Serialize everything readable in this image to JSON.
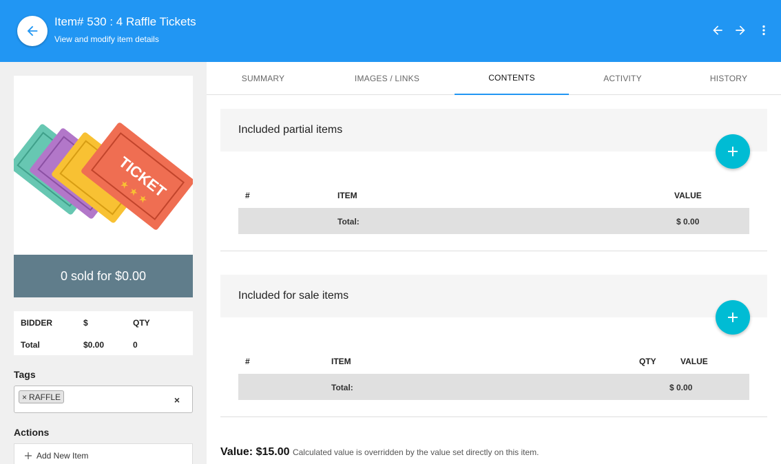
{
  "header": {
    "title": "Item# 530 : 4 Raffle Tickets",
    "subtitle": "View and modify item details",
    "back_icon": "arrow-left-icon",
    "prev_icon": "arrow-left-icon",
    "next_icon": "arrow-right-icon",
    "menu_icon": "more-vert-icon",
    "color": "#2196f3"
  },
  "sidebar": {
    "image_label": "TICKET",
    "sold_summary": "0 sold for $0.00",
    "bid_table": {
      "headers": [
        "BIDDER",
        "$",
        "QTY"
      ],
      "total_label": "Total",
      "total_amount": "$0.00",
      "total_qty": "0"
    },
    "tags_label": "Tags",
    "tags": [
      "RAFFLE"
    ],
    "tag_remove": "×",
    "tags_clear": "×",
    "actions_label": "Actions",
    "actions": [
      "Add New Item"
    ],
    "add_icon": "plus-icon"
  },
  "tabs": [
    {
      "label": "SUMMARY",
      "active": false
    },
    {
      "label": "IMAGES / LINKS",
      "active": false
    },
    {
      "label": "CONTENTS",
      "active": true
    },
    {
      "label": "ACTIVITY",
      "active": false
    },
    {
      "label": "HISTORY",
      "active": false
    }
  ],
  "partial_items": {
    "title": "Included partial items",
    "columns": [
      "#",
      "ITEM",
      "VALUE"
    ],
    "total_label": "Total:",
    "total_value": "$ 0.00"
  },
  "sale_items": {
    "title": "Included for sale items",
    "columns": [
      "#",
      "ITEM",
      "QTY",
      "VALUE"
    ],
    "total_label": "Total:",
    "total_value": "$ 0.00"
  },
  "value": {
    "main": "Value: $15.00",
    "note": "Calculated value is overridden by the value set directly on this item."
  },
  "colors": {
    "accent": "#2196f3",
    "fab": "#00bcd4",
    "banner": "#607d8b"
  }
}
